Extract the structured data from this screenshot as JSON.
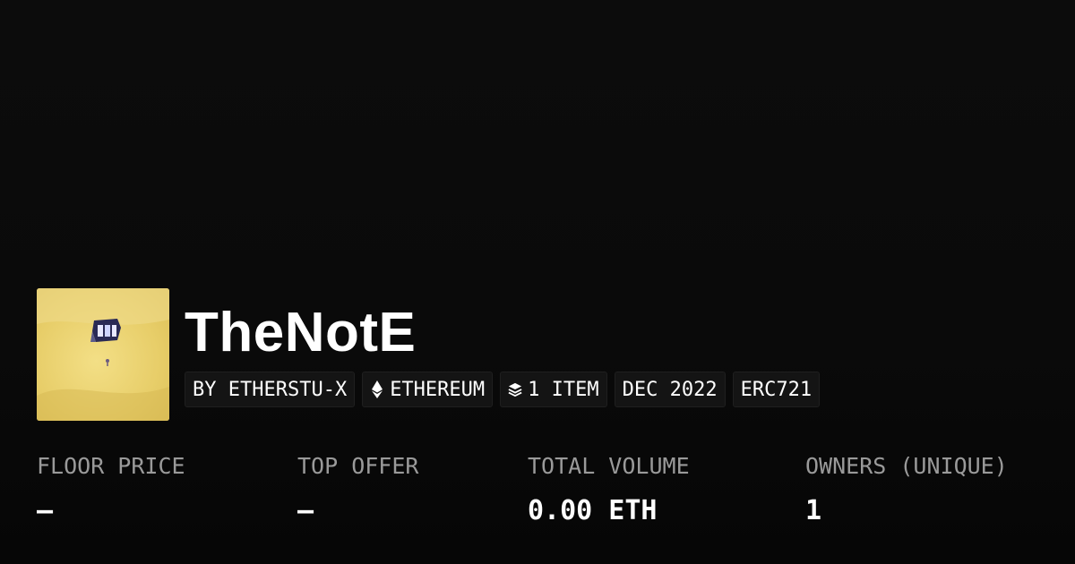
{
  "collection": {
    "name": "TheNotE",
    "thumbnail_icon": "collection-artwork-icon"
  },
  "tags": [
    {
      "label": "BY ETHERSTU-X",
      "icon": ""
    },
    {
      "label": "ETHEREUM",
      "icon": "ethereum-icon"
    },
    {
      "label": "1 ITEM",
      "icon": "layers-icon"
    },
    {
      "label": "DEC 2022",
      "icon": ""
    },
    {
      "label": "ERC721",
      "icon": ""
    }
  ],
  "stats": [
    {
      "label": "FLOOR PRICE",
      "value": "—"
    },
    {
      "label": "TOP OFFER",
      "value": "—"
    },
    {
      "label": "TOTAL VOLUME",
      "value": "0.00 ETH"
    },
    {
      "label": "OWNERS (UNIQUE)",
      "value": "1"
    }
  ],
  "colors": {
    "background": "#0a0a0a",
    "tag_background": "#141414",
    "label_gray": "#9a9a9a",
    "text": "#ffffff"
  }
}
